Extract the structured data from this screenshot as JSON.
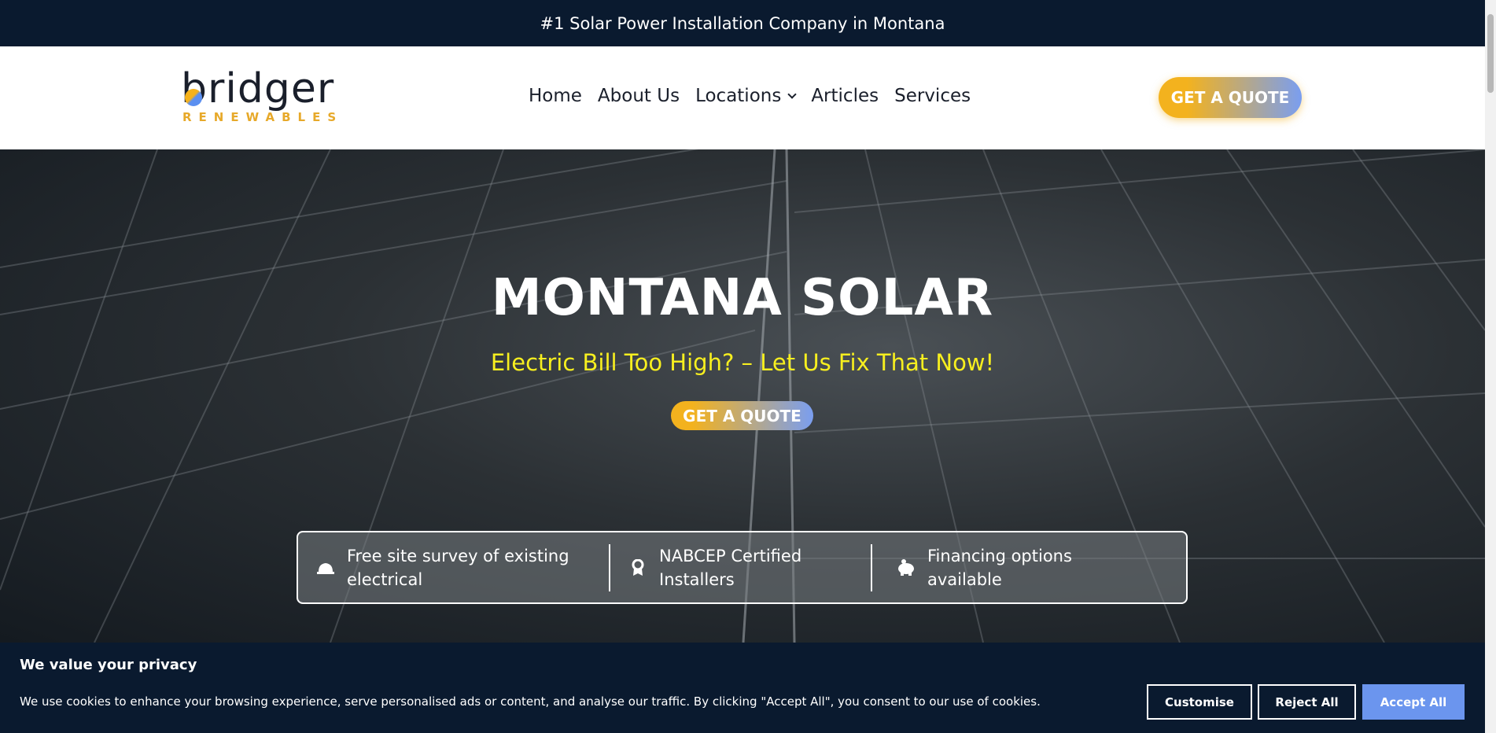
{
  "topbar": {
    "text": "#1 Solar Power Installation Company in Montana"
  },
  "logo": {
    "word": "bridger",
    "sub": "RENEWABLES"
  },
  "nav": {
    "items": [
      {
        "label": "Home"
      },
      {
        "label": "About Us"
      },
      {
        "label": "Locations"
      },
      {
        "label": "Articles"
      },
      {
        "label": "Services"
      }
    ],
    "cta": "GET A QUOTE"
  },
  "hero": {
    "title": "MONTANA SOLAR",
    "subtitle": "Electric Bill Too High? – Let Us Fix That Now!",
    "cta": "GET A QUOTE"
  },
  "features": [
    {
      "icon": "hard-hat-icon",
      "line1": "Free site survey of existing",
      "line2": "electrical"
    },
    {
      "icon": "award-icon",
      "line1": "NABCEP Certified",
      "line2": "Installers"
    },
    {
      "icon": "piggy-bank-icon",
      "line1": "Financing options",
      "line2": "available"
    }
  ],
  "cookie": {
    "title": "We value your privacy",
    "text": "We use cookies to enhance your browsing experience, serve personalised ads or content, and analyse our traffic. By clicking \"Accept All\", you consent to our use of cookies.",
    "customise": "Customise",
    "reject": "Reject All",
    "accept": "Accept All"
  },
  "colors": {
    "navy": "#0a1a2f",
    "accent_orange": "#f3b21e",
    "accent_blue": "#6b95ee",
    "hero_subtitle": "#f7ef1f"
  }
}
